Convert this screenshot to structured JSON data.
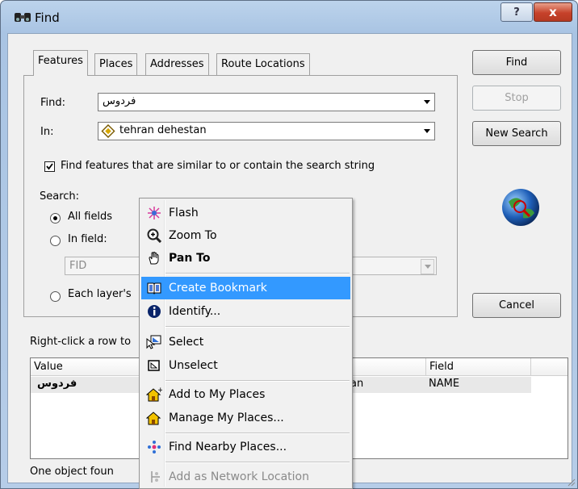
{
  "window": {
    "title": "Find",
    "help_label": "?",
    "close_label": "x"
  },
  "tabs": [
    "Features",
    "Places",
    "Addresses",
    "Route Locations"
  ],
  "form": {
    "find_label": "Find:",
    "find_value": "فردوس",
    "in_label": "In:",
    "in_value": "tehran dehestan",
    "similar_checkbox_label": "Find features that are similar to or contain the search string",
    "similar_checked": true,
    "search_label": "Search:",
    "radio_all_fields": "All fields",
    "radio_in_field": "In field:",
    "field_value": "FID",
    "radio_each_layer": "Each layer's"
  },
  "buttons": {
    "find": "Find",
    "stop": "Stop",
    "new_search": "New Search",
    "cancel": "Cancel"
  },
  "results": {
    "hint": "Right-click a row to",
    "columns": [
      "Value",
      "Field"
    ],
    "rows": [
      {
        "value": "فردوس",
        "layer": "an",
        "field": "NAME"
      }
    ],
    "status": "One object foun"
  },
  "context_menu": [
    {
      "label": "Flash",
      "icon": "flash-icon"
    },
    {
      "label": "Zoom To",
      "icon": "zoom-icon"
    },
    {
      "label": "Pan To",
      "icon": "pan-hand-icon",
      "bold": true
    },
    {
      "separator": true
    },
    {
      "label": "Create Bookmark",
      "icon": "bookmark-icon",
      "highlighted": true
    },
    {
      "label": "Identify...",
      "icon": "info-icon"
    },
    {
      "separator": true
    },
    {
      "label": "Select",
      "icon": "select-icon"
    },
    {
      "label": "Unselect",
      "icon": "unselect-icon"
    },
    {
      "separator": true
    },
    {
      "label": "Add to My Places",
      "icon": "add-place-icon"
    },
    {
      "label": "Manage My Places...",
      "icon": "manage-places-icon"
    },
    {
      "separator": true
    },
    {
      "label": "Find Nearby Places...",
      "icon": "nearby-places-icon"
    },
    {
      "separator": true
    },
    {
      "label": "Add as Network Location",
      "icon": "network-location-icon",
      "disabled": true
    }
  ],
  "colors": {
    "highlight": "#3399ff",
    "title_bar": "#b9d1ea",
    "close_button": "#c6412a"
  }
}
